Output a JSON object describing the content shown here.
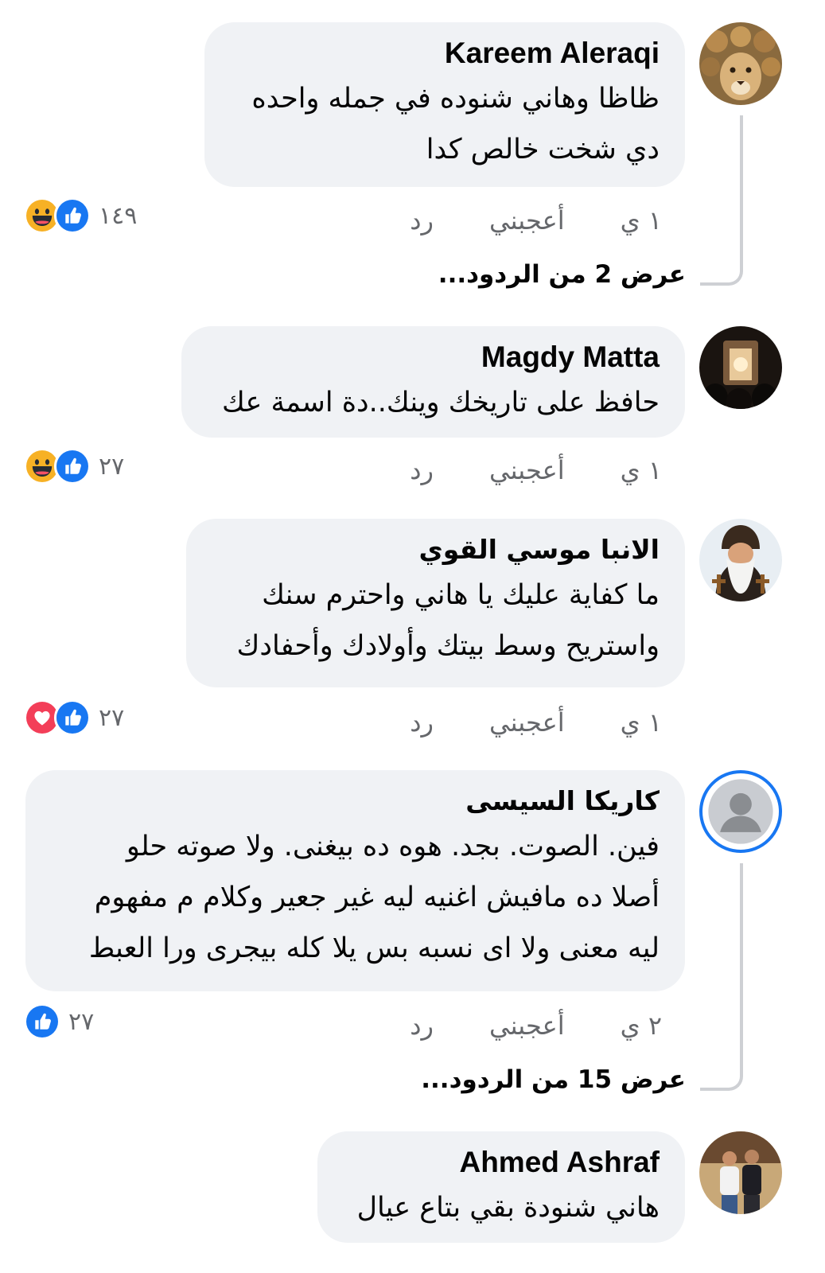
{
  "colors": {
    "bubble_bg": "#f0f2f5",
    "meta_text": "#65676b",
    "like_blue": "#1877f2",
    "love_red": "#f33e58",
    "haha_yellow": "#f7b125",
    "story_ring": "#1877f2"
  },
  "comments": [
    {
      "author": "Kareem Aleraqi",
      "avatar_icon": "lion-avatar-icon",
      "lines": [
        "ظاظا وهاني شنوده في جمله واحده",
        "دي شخت خالص كدا"
      ],
      "time": "١ ي",
      "like_label": "أعجبني",
      "reply_label": "رد",
      "reaction_icons": [
        "like-icon",
        "haha-icon"
      ],
      "reaction_count": "١٤٩",
      "view_replies": "عرض 2 من الردود..."
    },
    {
      "author": "Magdy Matta",
      "avatar_icon": "church-altar-avatar-icon",
      "lines": [
        "حافظ على تاريخك وينك..دة اسمة عك"
      ],
      "time": "١ ي",
      "like_label": "أعجبني",
      "reply_label": "رد",
      "reaction_icons": [
        "like-icon",
        "haha-icon"
      ],
      "reaction_count": "٢٧"
    },
    {
      "author": "الانبا موسي القوي",
      "avatar_icon": "monk-avatar-icon",
      "lines": [
        "ما كفاية عليك يا هاني واحترم سنك",
        "واستريح وسط بيتك وأولادك وأحفادك"
      ],
      "time": "١ ي",
      "like_label": "أعجبني",
      "reply_label": "رد",
      "reaction_icons": [
        "like-icon",
        "love-icon"
      ],
      "reaction_count": "٢٧"
    },
    {
      "author": "كاريكا السيسى",
      "avatar_icon": "default-user-avatar-icon",
      "lines": [
        "فين. الصوت. بجد. هوه ده بيغنى. ولا صوته حلو",
        "أصلا ده مافيش اغنيه ليه غير جعير وكلام م مفهوم",
        "ليه معنى ولا اى نسبه بس يلا كله بيجرى ورا العبط"
      ],
      "time": "٢ ي",
      "like_label": "أعجبني",
      "reply_label": "رد",
      "reaction_icons": [
        "like-icon"
      ],
      "reaction_count": "٢٧",
      "view_replies": "عرض 15 من الردود..."
    },
    {
      "author": "Ahmed Ashraf",
      "avatar_icon": "two-men-avatar-icon",
      "lines": [
        "هاني شنودة بقي بتاع عيال"
      ]
    }
  ]
}
